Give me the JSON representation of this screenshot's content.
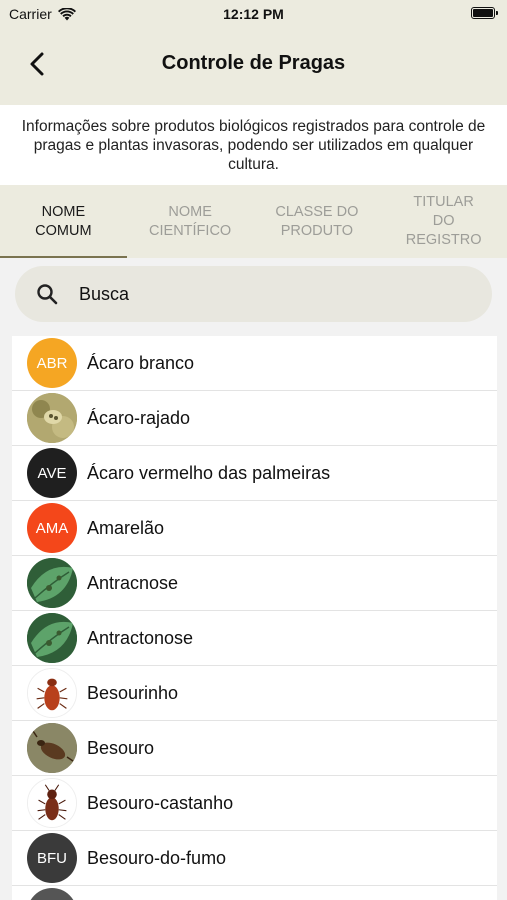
{
  "status_bar": {
    "carrier": "Carrier",
    "time": "12:12 PM"
  },
  "nav": {
    "title": "Controle de Pragas"
  },
  "description": "Informações sobre produtos biológicos registrados para controle de pragas e plantas invasoras, podendo ser utilizados em qualquer cultura.",
  "tabs": [
    {
      "line1": "NOME",
      "line2": "COMUM",
      "line3": "",
      "active": true
    },
    {
      "line1": "NOME",
      "line2": "CIENTÍFICO",
      "line3": "",
      "active": false
    },
    {
      "line1": "CLASSE DO",
      "line2": "PRODUTO",
      "line3": "",
      "active": false
    },
    {
      "line1": "TITULAR",
      "line2": "DO",
      "line3": "REGISTRO",
      "active": false
    }
  ],
  "search": {
    "placeholder": "Busca"
  },
  "items": [
    {
      "label": "Ácaro branco",
      "avatar_text": "ABR",
      "avatar_color": "#f5a623",
      "icon": ""
    },
    {
      "label": "Ácaro-rajado",
      "avatar_text": "",
      "avatar_color": "#a39a5c",
      "icon": "mite-photo-icon"
    },
    {
      "label": "Ácaro vermelho das palmeiras",
      "avatar_text": "AVE",
      "avatar_color": "#1f1f1f",
      "icon": ""
    },
    {
      "label": "Amarelão",
      "avatar_text": "AMA",
      "avatar_color": "#f4471a",
      "icon": ""
    },
    {
      "label": "Antracnose",
      "avatar_text": "",
      "avatar_color": "#3e7d4a",
      "icon": "leaf-photo-icon"
    },
    {
      "label": "Antractonose",
      "avatar_text": "",
      "avatar_color": "#3e7d4a",
      "icon": "leaf-photo-icon"
    },
    {
      "label": "Besourinho",
      "avatar_text": "",
      "avatar_color": "#ffffff",
      "icon": "beetle-photo-icon"
    },
    {
      "label": "Besouro",
      "avatar_text": "",
      "avatar_color": "#6b6a52",
      "icon": "beetle-photo-icon"
    },
    {
      "label": "Besouro-castanho",
      "avatar_text": "",
      "avatar_color": "#ffffff",
      "icon": "beetle-photo-icon"
    },
    {
      "label": "Besouro-do-fumo",
      "avatar_text": "BFU",
      "avatar_color": "#3a3a3a",
      "icon": ""
    },
    {
      "label": "",
      "avatar_text": "",
      "avatar_color": "#555555",
      "icon": ""
    }
  ]
}
